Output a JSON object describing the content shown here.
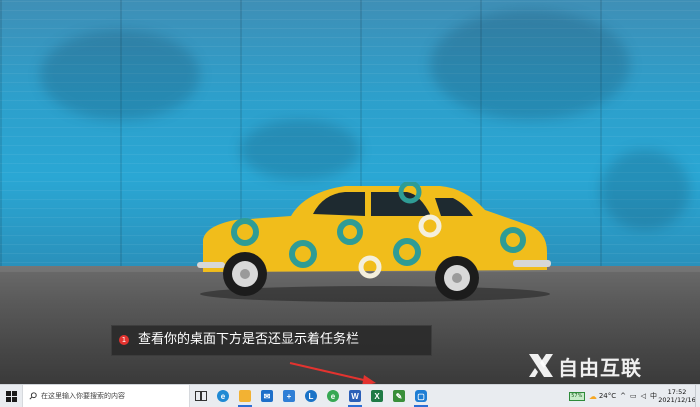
{
  "annotation": {
    "step_number": "1",
    "text": "查看你的桌面下方是否还显示着任务栏"
  },
  "watermark": {
    "text": "自由互联"
  },
  "taskbar": {
    "search_placeholder": "在这里输入你要搜索的内容",
    "pinned_apps": [
      {
        "name": "task-view-icon",
        "color": "#333333"
      },
      {
        "name": "edge-icon",
        "color": "#1f8ad4"
      },
      {
        "name": "file-explorer-icon",
        "color": "#f2b233"
      },
      {
        "name": "mail-icon",
        "color": "#1e6fc9"
      },
      {
        "name": "store-icon",
        "color": "#2f7fd6"
      },
      {
        "name": "app-icon",
        "color": "#1a73c7"
      },
      {
        "name": "browser-icon",
        "color": "#36a853"
      },
      {
        "name": "word-icon",
        "color": "#2b5fb8",
        "label": "W"
      },
      {
        "name": "excel-icon",
        "color": "#1f7a45",
        "label": "X"
      },
      {
        "name": "notes-icon",
        "color": "#3a8f3a"
      },
      {
        "name": "app-blue-icon",
        "color": "#1e7ed4"
      }
    ],
    "tray": {
      "battery_percent": "57%",
      "temperature": "24°C",
      "ime": "中",
      "time": "17:52",
      "date": "2021/12/16"
    }
  },
  "colors": {
    "wall": "#2aa7d4",
    "car": "#f1bd1b",
    "taskbar": "#e9ecf0",
    "annotation_badge": "#e3332f",
    "arrow": "#e3332f"
  }
}
